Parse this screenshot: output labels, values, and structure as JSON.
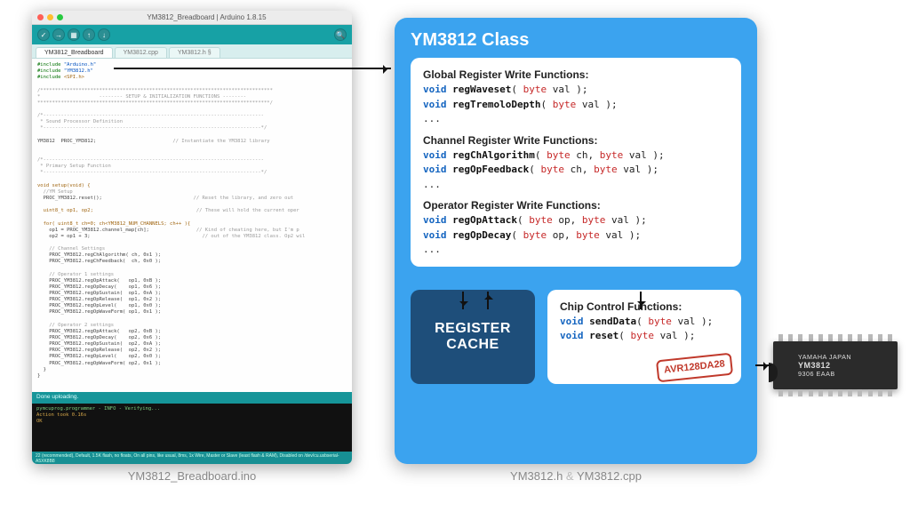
{
  "ide": {
    "title": "YM3812_Breadboard | Arduino 1.8.15",
    "tabs": [
      "YM3812_Breadboard",
      "YM3812.cpp",
      "YM3812.h §"
    ],
    "code": {
      "inc1a": "#include",
      "inc1b": "\"Arduino.h\"",
      "inc2a": "#include",
      "inc2b": "\"YM3812.h\"",
      "inc3a": "#include",
      "inc3b": "<SPI.h>",
      "divider1": "/*******************************************************************************",
      "divheader": "*                    -------- SETUP & INITIALIZATION FUNCTIONS --------",
      "divider2": "*******************************************************************************/",
      "snd1": "/*---------------------------------------------------------------------------",
      "snd2": " * Sound Processor Definition",
      "snd3": " *--------------------------------------------------------------------------*/",
      "inst": "YM3812  PROC_YM3812;",
      "inst_cm": "// Instantiate the YM3812 library",
      "pri1": "/*---------------------------------------------------------------------------",
      "pri2": " * Primary Setup Function",
      "pri3": " *--------------------------------------------------------------------------*/",
      "setup1": "void setup(void) {",
      "setup2": "  //YM Setup",
      "setup3": "  PROC_YM3812.reset();",
      "setup3_cm": "// Reset the library, and zero out",
      "setup4": "  uint8_t op1, op2;",
      "setup4_cm": "// These will hold the current oper",
      "for1": "  for( uint8_t ch=0; ch<YM3812_NUM_CHANNELS; ch++ ){",
      "for2": "    op1 = PROC_YM3812.channel_map[ch];",
      "for2_cm": "// Kind of cheating here, but I'm p",
      "for3": "    op2 = op1 + 3;",
      "for3_cm": "// out of the YM3812 class. Op2 wil",
      "chset": "    // Channel Settings",
      "ch1": "    PROC_YM3812.regChAlgorithm( ch, 0x1 );",
      "ch2": "    PROC_YM3812.regChFeedback(  ch, 0x0 );",
      "op1set": "    // Operator 1 settings",
      "o1a": "    PROC_YM3812.regOpAttack(   op1, 0xB );",
      "o1b": "    PROC_YM3812.regOpDecay(    op1, 0x6 );",
      "o1c": "    PROC_YM3812.regOpSustain(  op1, 0xA );",
      "o1d": "    PROC_YM3812.regOpRelease(  op1, 0x2 );",
      "o1e": "    PROC_YM3812.regOpLevel(    op1, 0x0 );",
      "o1f": "    PROC_YM3812.regOpWaveForm( op1, 0x1 );",
      "op2set": "    // Operator 2 settings",
      "o2a": "    PROC_YM3812.regOpAttack(   op2, 0xB );",
      "o2b": "    PROC_YM3812.regOpDecay(    op2, 0x6 );",
      "o2c": "    PROC_YM3812.regOpSustain(  op2, 0xA );",
      "o2d": "    PROC_YM3812.regOpRelease(  op2, 0x2 );",
      "o2e": "    PROC_YM3812.regOpLevel(    op2, 0x0 );",
      "o2f": "    PROC_YM3812.regOpWaveForm( op2, 0x1 );",
      "close1": "  }",
      "close2": "}"
    },
    "uploading": "Done uploading.",
    "console": [
      "pymcuprog.programmer - INFO - Verifying...",
      "Action took 0.16s",
      "OK"
    ],
    "statusbar": "22 (recommended), Default, 1.5K flash, no floats, On all pins, like usual, 8ms, 1x Wire, Master or Slave (least flash & RAM), Disabled on /dev/cu.usbserial-A5XK8B8"
  },
  "caption_left": "YM3812_Breadboard.ino",
  "classbox": {
    "title": "YM3812 Class",
    "global_header": "Global Register Write Functions:",
    "g1_kw": "void",
    "g1_fn": "regWaveset",
    "g1_ty": "byte",
    "g1_tail": " val );",
    "g2_kw": "void",
    "g2_fn": "regTremoloDepth",
    "g2_ty": "byte",
    "g2_tail": " val );",
    "ell1": "...",
    "channel_header": "Channel Register Write Functions:",
    "c1_kw": "void",
    "c1_fn": "regChAlgorithm",
    "c1_t1": "byte",
    "c1_m": " ch, ",
    "c1_t2": "byte",
    "c1_tail": " val );",
    "c2_kw": "void",
    "c2_fn": "regOpFeedback",
    "c2_t1": "byte",
    "c2_m": " ch, ",
    "c2_t2": "byte",
    "c2_tail": " val );",
    "ell2": "...",
    "op_header": "Operator Register Write Functions:",
    "o1_kw": "void",
    "o1_fn": "regOpAttack",
    "o1_t1": "byte",
    "o1_m": " op, ",
    "o1_t2": "byte",
    "o1_tail": " val );",
    "o2_kw": "void",
    "o2_fn": "regOpDecay",
    "o2_t1": "byte",
    "o2_m": " op, ",
    "o2_t2": "byte",
    "o2_tail": " val );",
    "ell3": "...",
    "regcache_l1": "REGISTER",
    "regcache_l2": "CACHE",
    "chipfn_header": "Chip Control Functions:",
    "s1_kw": "void",
    "s1_fn": "sendData",
    "s1_ty": "byte",
    "s1_tail": " val );",
    "s2_kw": "void",
    "s2_fn": "reset",
    "s2_ty": "byte",
    "s2_tail": " val );",
    "stamp": "AVR128DA28"
  },
  "caption_right_a": "YM3812.h",
  "caption_right_amp": " & ",
  "caption_right_b": "YM3812.cpp",
  "chip": {
    "brand": "YAMAHA  JAPAN",
    "part": "YM3812",
    "lot": "9306 EAAB"
  }
}
